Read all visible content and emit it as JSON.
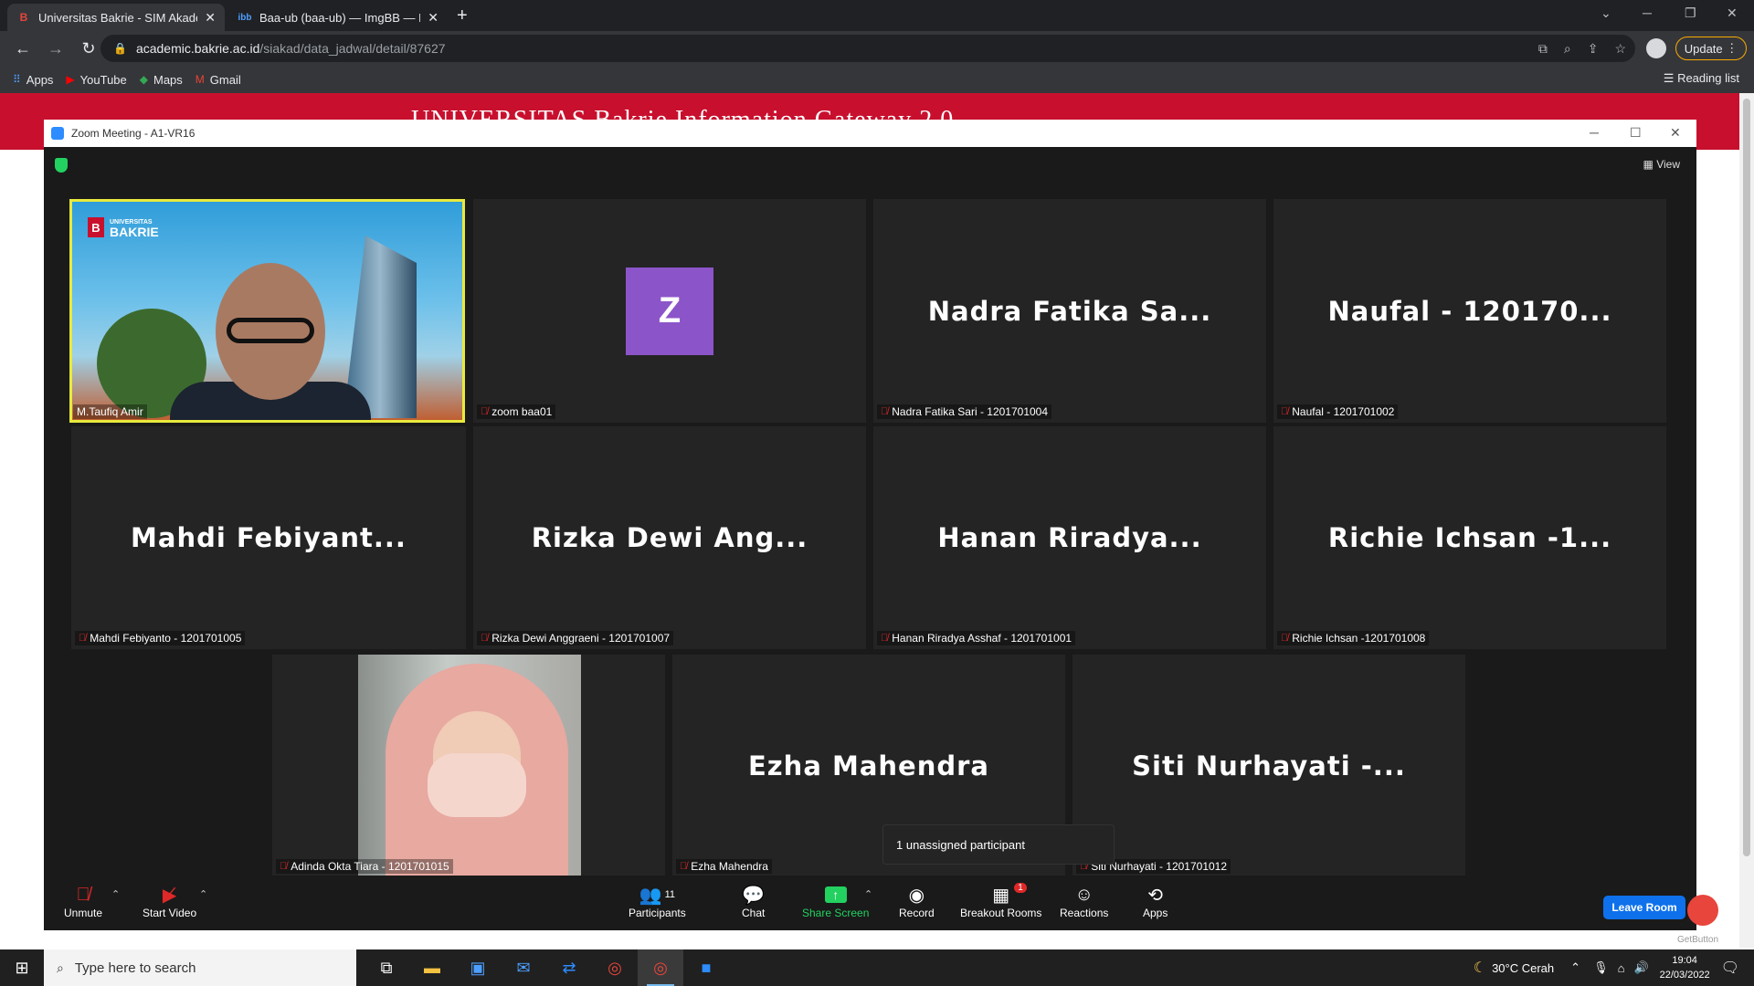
{
  "browser": {
    "tabs": [
      {
        "label": "Universitas Bakrie - SIM Akademi",
        "icon": "B",
        "active": true
      },
      {
        "label": "Baa-ub (baa-ub) — ImgBB — Lar",
        "icon": "ibb",
        "active": false
      }
    ],
    "url_host": "academic.bakrie.ac.id",
    "url_path": "/siakad/data_jadwal/detail/87627",
    "update_label": "Update",
    "bookmarks": [
      {
        "label": "Apps",
        "icon": "apps-grid-icon"
      },
      {
        "label": "YouTube",
        "icon": "youtube-icon"
      },
      {
        "label": "Maps",
        "icon": "maps-icon"
      },
      {
        "label": "Gmail",
        "icon": "gmail-icon"
      }
    ],
    "reading_list": "Reading list"
  },
  "page": {
    "header_text": "UNIVERSITAS  Bakrie Information Gateway 2.0"
  },
  "zoom": {
    "window_title": "Zoom Meeting - A1-VR16",
    "view_label": "View",
    "tiles": [
      {
        "label": "M.Taufiq Amir",
        "video": true
      },
      {
        "label": "zoom baa01",
        "avatar": "Z"
      },
      {
        "big": "Nadra Fatika Sa...",
        "label": "Nadra Fatika Sari - 1201701004"
      },
      {
        "big": "Naufal - 120170...",
        "label": "Naufal - 1201701002"
      },
      {
        "big": "Mahdi Febiyant...",
        "label": "Mahdi Febiyanto - 1201701005"
      },
      {
        "big": "Rizka Dewi Ang...",
        "label": "Rizka Dewi Anggraeni - 1201701007"
      },
      {
        "big": "Hanan Riradya...",
        "label": "Hanan Riradya Asshaf - 1201701001"
      },
      {
        "big": "Richie Ichsan -1...",
        "label": "Richie Ichsan -1201701008"
      },
      {
        "label": "Adinda Okta Tiara - 1201701015",
        "video": true
      },
      {
        "big": "Ezha Mahendra",
        "label": "Ezha Mahendra"
      },
      {
        "big": "Siti Nurhayati -...",
        "label": "Siti Nurhayati - 1201701012"
      }
    ],
    "logo_text": "BAKRIE",
    "logo_small": "UNIVERSITAS",
    "tooltip": "1 unassigned participant",
    "toolbar": {
      "unmute": "Unmute",
      "start_video": "Start Video",
      "participants": "Participants",
      "participants_count": "11",
      "chat": "Chat",
      "share_screen": "Share Screen",
      "record": "Record",
      "breakout_rooms": "Breakout Rooms",
      "breakout_badge": "1",
      "reactions": "Reactions",
      "apps": "Apps",
      "leave_room": "Leave Room"
    },
    "getbutton": "GetButton"
  },
  "taskbar": {
    "search_placeholder": "Type here to search",
    "weather": "30°C  Cerah",
    "time": "19:04",
    "date": "22/03/2022"
  },
  "colors": {
    "accent_red": "#c8102e",
    "zoom_blue": "#0e71eb",
    "share_green": "#23d160",
    "active_speaker": "#e8ea3c",
    "avatar_purple": "#8c54c9"
  }
}
